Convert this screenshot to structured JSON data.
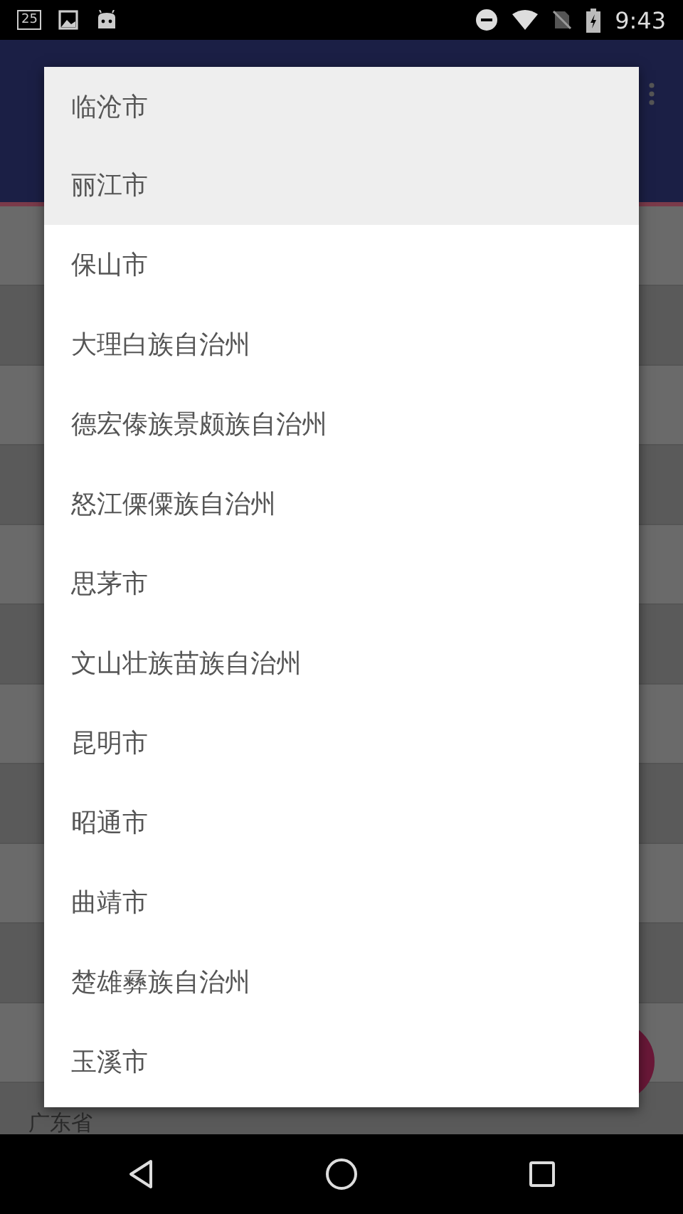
{
  "status_bar": {
    "notification_badge": "25",
    "time": "9:43"
  },
  "background_list": [
    {
      "label": "广东省"
    }
  ],
  "dialog": {
    "items": [
      {
        "label": "临沧市",
        "highlighted": true
      },
      {
        "label": "丽江市",
        "highlighted": true
      },
      {
        "label": "保山市",
        "highlighted": false
      },
      {
        "label": "大理白族自治州",
        "highlighted": false
      },
      {
        "label": "德宏傣族景颇族自治州",
        "highlighted": false
      },
      {
        "label": "怒江傈僳族自治州",
        "highlighted": false
      },
      {
        "label": "思茅市",
        "highlighted": false
      },
      {
        "label": "文山壮族苗族自治州",
        "highlighted": false
      },
      {
        "label": "昆明市",
        "highlighted": false
      },
      {
        "label": "昭通市",
        "highlighted": false
      },
      {
        "label": "曲靖市",
        "highlighted": false
      },
      {
        "label": "楚雄彝族自治州",
        "highlighted": false
      },
      {
        "label": "玉溪市",
        "highlighted": false
      }
    ]
  }
}
